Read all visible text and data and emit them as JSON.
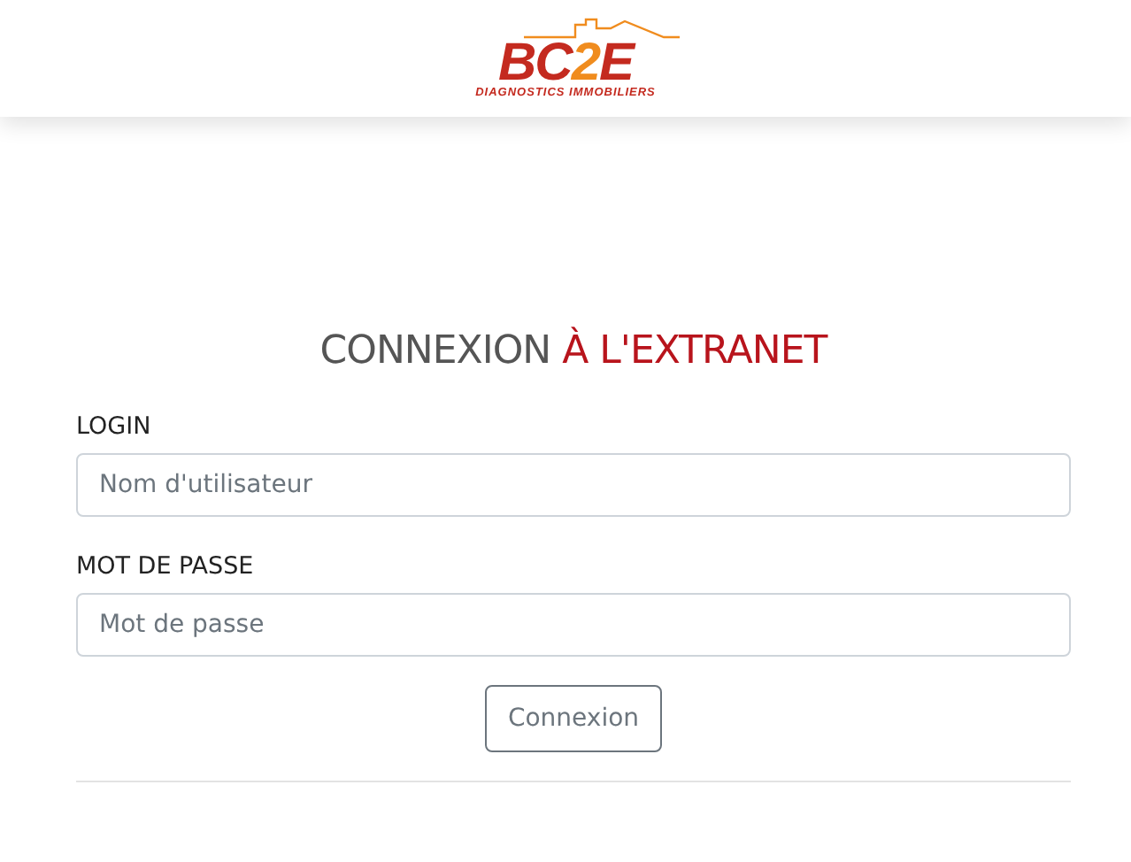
{
  "logo": {
    "letters": [
      {
        "text": "BC",
        "color": "#c42a1f"
      },
      {
        "text": "2",
        "color": "#f08c1e"
      },
      {
        "text": "E",
        "color": "#c42a1f"
      }
    ],
    "tagline": "DIAGNOSTICS IMMOBILIERS"
  },
  "heading": {
    "lead": "CONNEXION",
    "accent": "À L'EXTRANET"
  },
  "fields": [
    {
      "label": "LOGIN",
      "placeholder": "Nom d'utilisateur"
    },
    {
      "label": "MOT DE PASSE",
      "placeholder": "Mot de passe"
    }
  ],
  "submit": "Connexion"
}
